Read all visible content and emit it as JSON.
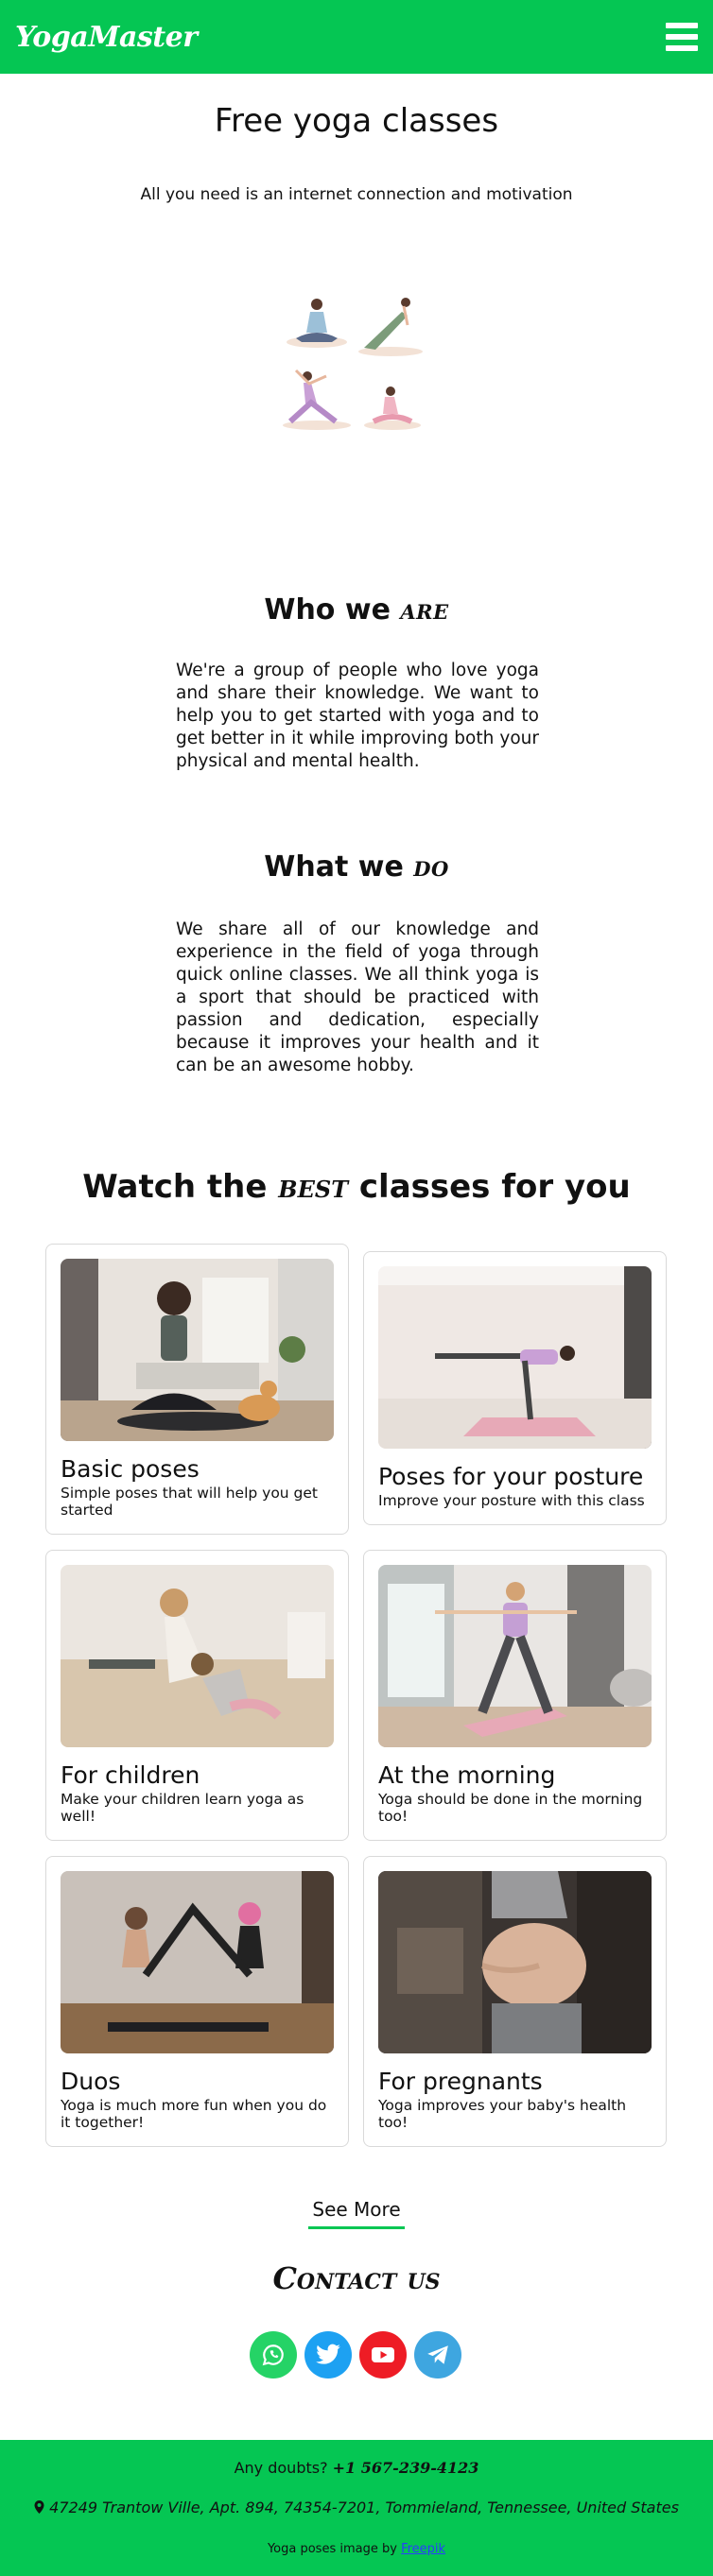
{
  "header": {
    "logo": "YogaMaster",
    "menu_icon": "hamburger-menu-icon",
    "bg_color": "#05c653"
  },
  "hero": {
    "title": "Free yoga classes",
    "subtitle": "All you need is an internet connection and motivation"
  },
  "about": {
    "title_prefix": "Who we ",
    "title_accent": "are",
    "text": "We're a group of people who love yoga and share their knowledge. We want to help you to get started with yoga and to get better in it while improving both your physical and mental health."
  },
  "what": {
    "title_prefix": "What we ",
    "title_accent": "do",
    "text": "We share all of our knowledge and experience in the field of yoga through quick online classes. We all think yoga is a sport that should be practiced with passion and dedication, especially because it improves your health and it can be an awesome hobby."
  },
  "classes": {
    "title_prefix": "Watch the ",
    "title_accent": "best",
    "title_suffix": " classes for you",
    "cards": [
      {
        "title": "Basic poses",
        "description": "Simple poses that will help you get started"
      },
      {
        "title": "Poses for your posture",
        "description": "Improve your posture with this class"
      },
      {
        "title": "For children",
        "description": "Make your children learn yoga as well!"
      },
      {
        "title": "At the morning",
        "description": "Yoga should be done in the morning too!"
      },
      {
        "title": "Duos",
        "description": "Yoga is much more fun when you do it together!"
      },
      {
        "title": "For pregnants",
        "description": "Yoga improves your baby's health too!"
      }
    ],
    "see_more": "See More"
  },
  "contact": {
    "title": "Contact us",
    "socials": [
      {
        "name": "whatsapp-icon",
        "color": "#25d366"
      },
      {
        "name": "twitter-icon",
        "color": "#1da1f2"
      },
      {
        "name": "youtube-icon",
        "color": "#ff0000"
      },
      {
        "name": "telegram-icon",
        "color": "#3ea6e0"
      }
    ]
  },
  "footer": {
    "doubts_label": "Any doubts? ",
    "phone": "+1 567-239-4123",
    "address": "47249 Trantow Ville, Apt. 894, 74354-7201, Tommieland, Tennessee, United States",
    "credit_prefix": "Yoga poses image by ",
    "credit_link": "Freepik"
  }
}
